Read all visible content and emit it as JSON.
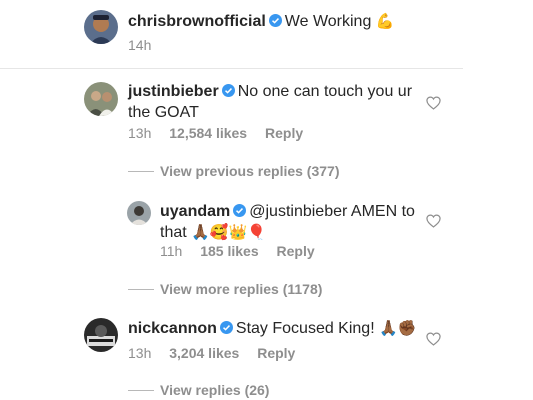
{
  "post": {
    "username": "chrisbrownofficial",
    "text": "We Working",
    "emoji": "💪",
    "time": "14h"
  },
  "comments": [
    {
      "username": "justinbieber",
      "text_line1": "No one can touch you ur",
      "text_line2": "the GOAT",
      "time": "13h",
      "likes": "12,584 likes",
      "reply": "Reply"
    },
    {
      "username": "nickcannon",
      "text": "Stay Focused King!",
      "emoji": "🙏🏾✊🏾",
      "time": "13h",
      "likes": "3,204 likes",
      "reply": "Reply"
    }
  ],
  "replies": [
    {
      "username": "uyandam",
      "mention": "@justinbieber",
      "text_line1": "AMEN to",
      "text_line2": "that",
      "emoji": "🙏🏾🥰👑🎈",
      "time": "11h",
      "likes": "185 likes",
      "reply": "Reply"
    }
  ],
  "thread_links": {
    "previous": "View previous replies (377)",
    "more": "View more replies (1178)",
    "view": "View replies (26)"
  },
  "colors": {
    "text": "#262626",
    "muted": "#8e8e8e",
    "verified": "#3897f0",
    "divider": "#e6e6e6"
  }
}
